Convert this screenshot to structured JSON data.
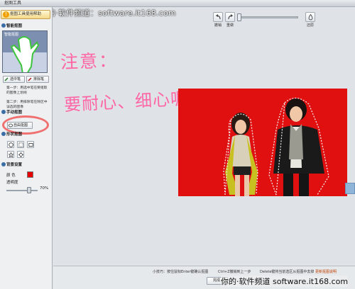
{
  "window": {
    "title": "抠图工具",
    "watermark_top": "你的·软件频道：software.it168.com",
    "watermark_bottom": "你的·软件频道 software.it168.com"
  },
  "left_panel": {
    "help_button": "抠图工具使用帮助",
    "smart_section": "智能抠图",
    "preview_label": "智能抠图",
    "select_button": "选中笔",
    "remove_button": "排除笔",
    "step1": "第一步：用选中笔在要抠取的图像上划线",
    "step2": "第二步：用排除笔在除区中误选的图像",
    "manual_section": "手动抠图",
    "auto_button": "自由抠图",
    "shape_section": "形状抠图",
    "settings_section": "背景设置",
    "color_label": "颜  色",
    "opacity_label": "透明度",
    "opacity_value": "70%",
    "colors": {
      "swatch": "#e60000",
      "ring": "#f06f6f"
    }
  },
  "toolbar": {
    "undo": "撤销",
    "redo": "重做",
    "restore": "还原"
  },
  "canvas": {
    "note_line1": "注意：",
    "note_line2": "要耐心、细心喔...",
    "photo_bg": "#e01010"
  },
  "bottom": {
    "tip1": "小技巧：按住鼠标Enter键确认抠图",
    "tip2": "Ctrl+Z撤销到上一步",
    "tip3": "Delete键将当前选区从抠图中去掉",
    "tip_link": "更新抠图说明",
    "done_button": "完成"
  }
}
